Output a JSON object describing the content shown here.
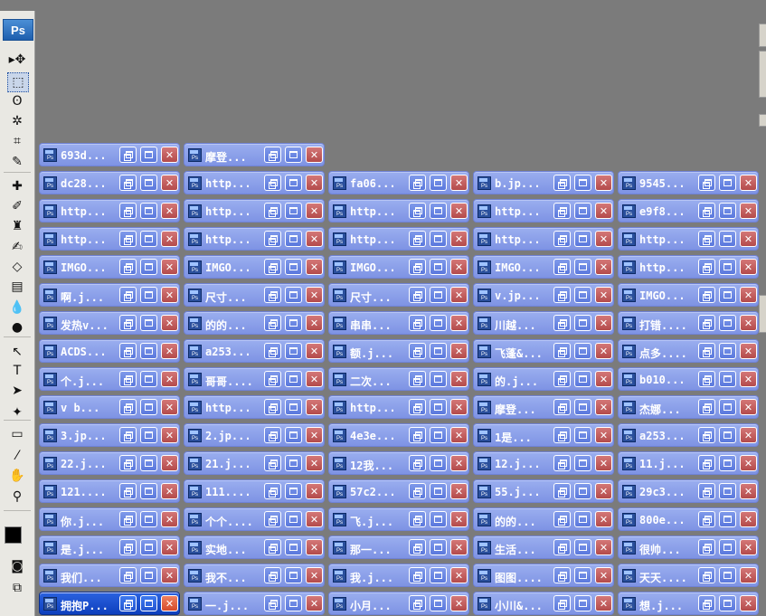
{
  "app": {
    "logo": "Ps"
  },
  "toolbox": {
    "tools": [
      {
        "name": "move-tool-icon",
        "glyph": "▸✥"
      },
      {
        "name": "marquee-tool-icon",
        "glyph": "⬚",
        "selected": true
      },
      {
        "name": "lasso-tool-icon",
        "glyph": "ʘ"
      },
      {
        "name": "magic-wand-tool-icon",
        "glyph": "✲"
      },
      {
        "name": "crop-tool-icon",
        "glyph": "⌗"
      },
      {
        "name": "slice-tool-icon",
        "glyph": "✎"
      },
      {
        "name": "healing-brush-tool-icon",
        "glyph": "✚"
      },
      {
        "name": "brush-tool-icon",
        "glyph": "✐"
      },
      {
        "name": "clone-stamp-tool-icon",
        "glyph": "♜"
      },
      {
        "name": "history-brush-tool-icon",
        "glyph": "✍"
      },
      {
        "name": "eraser-tool-icon",
        "glyph": "◇"
      },
      {
        "name": "gradient-tool-icon",
        "glyph": "▤"
      },
      {
        "name": "blur-tool-icon",
        "glyph": "💧"
      },
      {
        "name": "dodge-tool-icon",
        "glyph": "●"
      },
      {
        "name": "path-selection-tool-icon",
        "glyph": "↖"
      },
      {
        "name": "type-tool-icon",
        "glyph": "T"
      },
      {
        "name": "direct-selection-tool-icon",
        "glyph": "➤"
      },
      {
        "name": "custom-shape-tool-icon",
        "glyph": "✦"
      },
      {
        "name": "notes-tool-icon",
        "glyph": "▭"
      },
      {
        "name": "eyedropper-tool-icon",
        "glyph": "⁄"
      },
      {
        "name": "hand-tool-icon",
        "glyph": "✋"
      },
      {
        "name": "zoom-tool-icon",
        "glyph": "⚲"
      }
    ],
    "foreground_color": "#000000",
    "background_color": "#ffffff"
  },
  "documents": {
    "columns": [
      [
        "693d...",
        "dc28...",
        "http...",
        "http...",
        "IMGO...",
        "啊.j...",
        "发热v...",
        "ACDS...",
        "个.j...",
        "v b...",
        "3.jp...",
        "22.j...",
        "121....",
        "你.j...",
        "是.j...",
        "我们...",
        "拥抱P..."
      ],
      [
        "摩登...",
        "http...",
        "http...",
        "http...",
        "IMGO...",
        "尺寸...",
        "的的...",
        "a253...",
        "哥哥....",
        "http...",
        "2.jp...",
        "21.j...",
        "111....",
        "个个....",
        "实地...",
        "我不...",
        "一.j..."
      ],
      [
        "fa06...",
        "http...",
        "http...",
        "IMGO...",
        "尺寸...",
        "串串...",
        "额.j...",
        "二次...",
        "http...",
        "4e3e...",
        "12我...",
        "57c2...",
        "飞.j...",
        "那一...",
        "我.j...",
        "小月..."
      ],
      [
        "b.jp...",
        "http...",
        "http...",
        "IMGO...",
        "v.jp...",
        "川越...",
        "飞蓬&...",
        "的.j...",
        "摩登...",
        "1是...",
        "12.j...",
        "55.j...",
        "的的...",
        "生活...",
        "图图....",
        "小川&..."
      ],
      [
        "9545...",
        "e9f8...",
        "http...",
        "http...",
        "IMGO...",
        "打错....",
        "点多....",
        "b010...",
        "杰娜...",
        "a253...",
        "11.j...",
        "29c3...",
        "800e...",
        "很帅...",
        "天天....",
        "想.j..."
      ]
    ],
    "active": "拥抱P..."
  },
  "colors": {
    "doc_bar": "#8a9fea",
    "active_bar": "#1c4fd0",
    "workspace": "#7b7b7b"
  }
}
